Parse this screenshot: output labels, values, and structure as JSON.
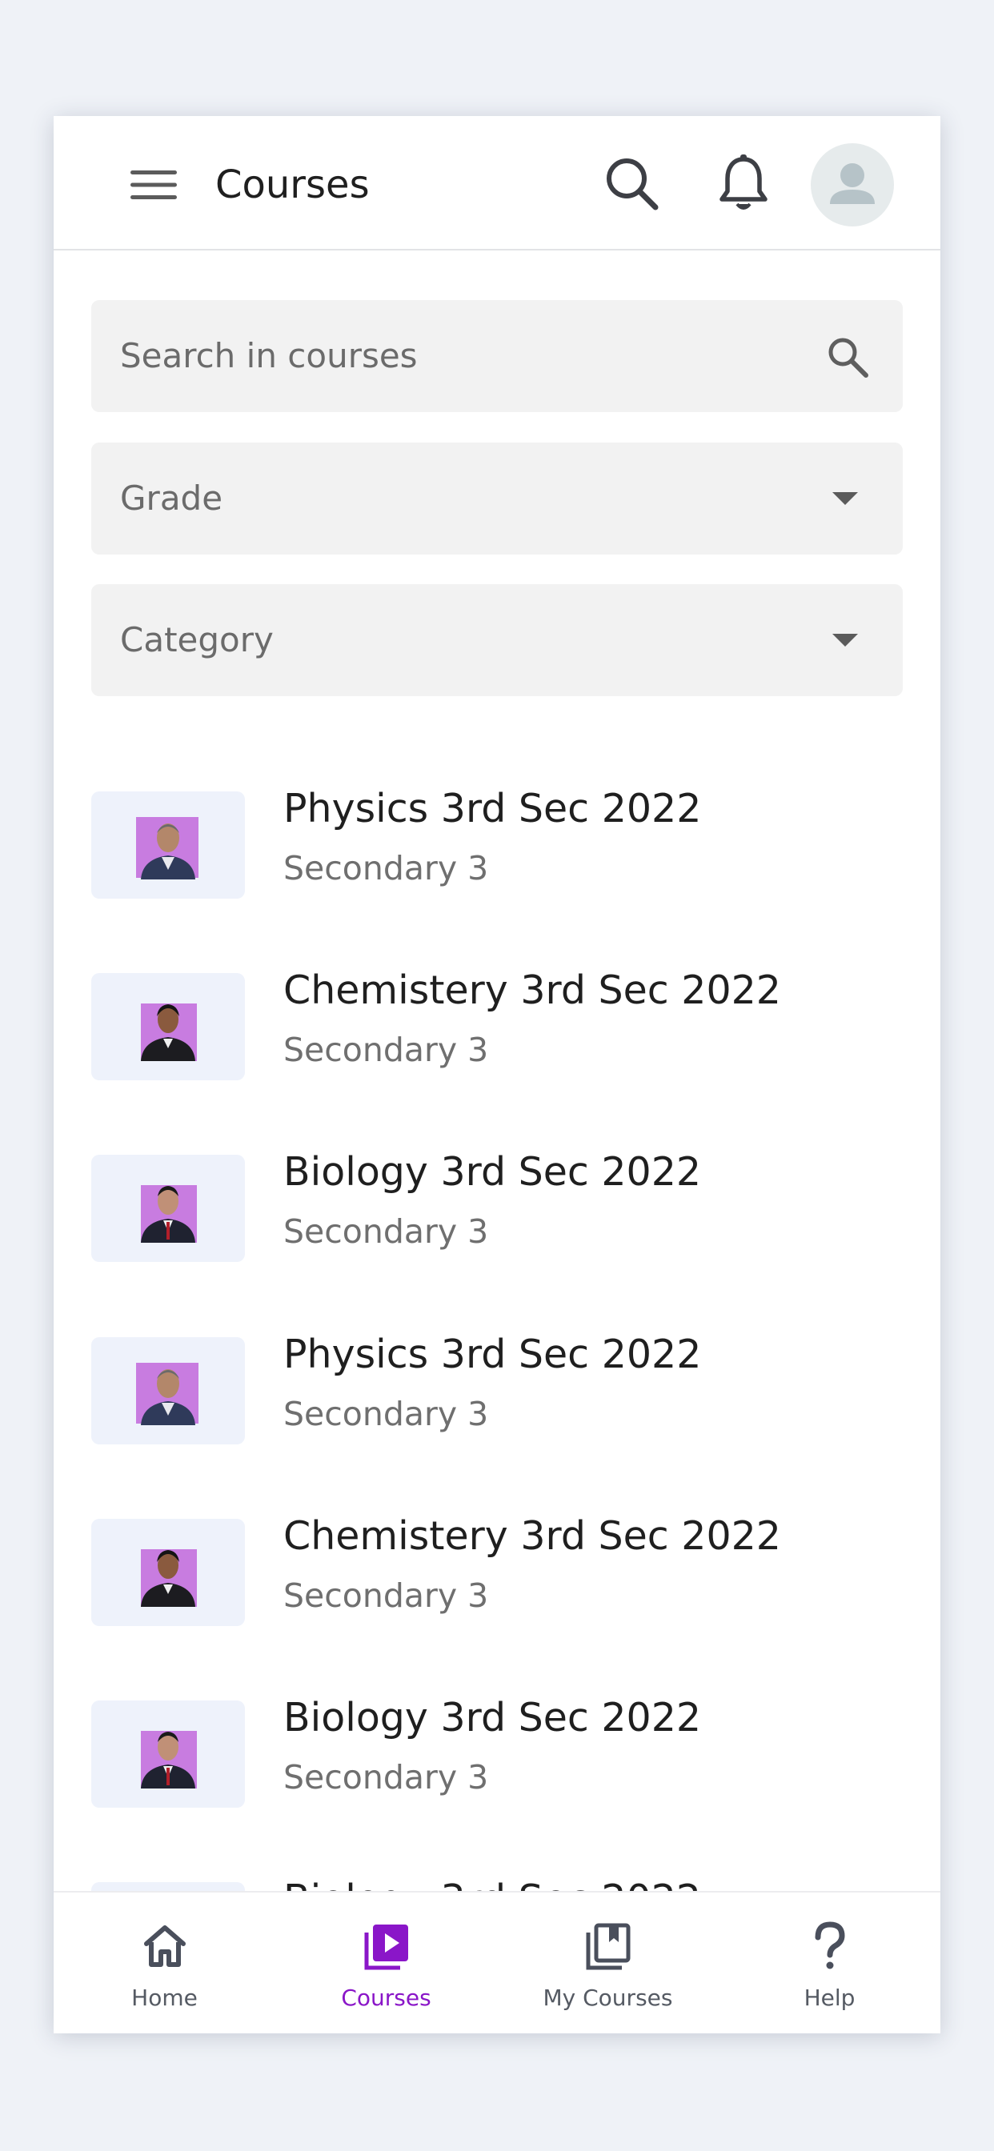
{
  "header": {
    "title": "Courses",
    "menu_icon": "hamburger-menu-icon",
    "search_icon": "search-icon",
    "notification_icon": "bell-icon",
    "avatar_icon": "user-avatar-icon"
  },
  "filters": {
    "search_placeholder": "Search in courses",
    "grade_label": "Grade",
    "category_label": "Category"
  },
  "courses": [
    {
      "title": "Physics 3rd Sec 2022",
      "grade": "Secondary 3"
    },
    {
      "title": "Chemistery 3rd Sec 2022",
      "grade": "Secondary 3"
    },
    {
      "title": "Biology 3rd Sec 2022",
      "grade": "Secondary 3"
    },
    {
      "title": "Physics 3rd Sec 2022",
      "grade": "Secondary 3"
    },
    {
      "title": "Chemistery 3rd Sec 2022",
      "grade": "Secondary 3"
    },
    {
      "title": "Biology 3rd Sec 2022",
      "grade": "Secondary 3"
    }
  ],
  "bottom_nav": [
    {
      "label": "Home",
      "icon": "home-icon"
    },
    {
      "label": "Courses",
      "icon": "video-library-icon",
      "active": true
    },
    {
      "label": "My Courses",
      "icon": "bookmark-collection-icon"
    },
    {
      "label": "Help",
      "icon": "question-mark-icon"
    }
  ],
  "colors": {
    "accent": "#8a16c8",
    "page_background": "#eff2f7",
    "field_background": "#f2f2f2",
    "thumb_background": "#eef2fb",
    "thumb_photo_background": "#c87ce0"
  }
}
